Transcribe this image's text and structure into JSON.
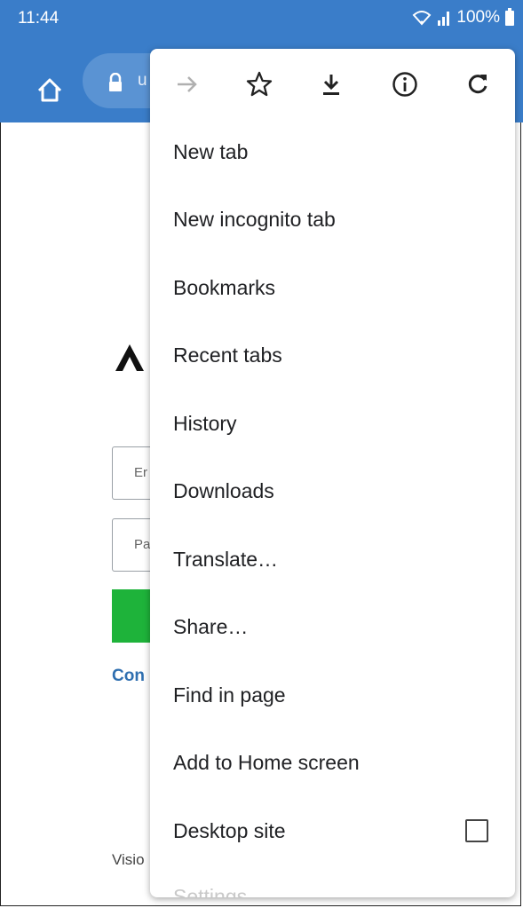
{
  "status": {
    "time": "11:44",
    "battery": "100%"
  },
  "address": {
    "text_fragment": "u"
  },
  "page_behind": {
    "logo_glyph": "Λ",
    "email_placeholder_fragment": "Er",
    "password_placeholder_fragment": "Pa",
    "link_fragment": "Con",
    "footer_fragment": "Visio"
  },
  "menu": {
    "actions": [
      "forward-icon",
      "bookmark-star-icon",
      "download-icon",
      "info-icon",
      "reload-icon"
    ],
    "items": [
      {
        "label": "New tab"
      },
      {
        "label": "New incognito tab"
      },
      {
        "label": "Bookmarks"
      },
      {
        "label": "Recent tabs"
      },
      {
        "label": "History"
      },
      {
        "label": "Downloads"
      },
      {
        "label": "Translate…"
      },
      {
        "label": "Share…"
      },
      {
        "label": "Find in page"
      },
      {
        "label": "Add to Home screen"
      },
      {
        "label": "Desktop site",
        "checked": false
      },
      {
        "label": "Settings"
      }
    ]
  },
  "colors": {
    "toolbar": "#3a7dc9",
    "button_green": "#1eb33a",
    "link_blue": "#2f6fb0"
  }
}
